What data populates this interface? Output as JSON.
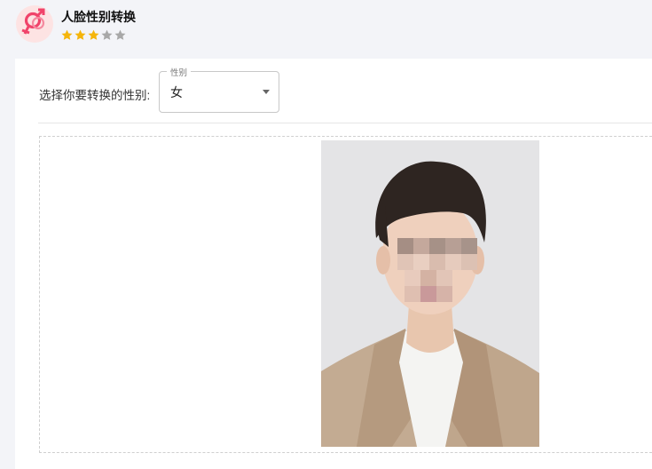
{
  "app": {
    "title": "人脸性别转换",
    "icon": "gender-swap-icon",
    "rating": 3,
    "rating_max": 5,
    "star_color_on": "#f5b50a",
    "star_color_off": "#a8a8a8"
  },
  "form": {
    "gender_label": "选择你要转换的性别:",
    "gender_select": {
      "legend": "性别",
      "value": "女"
    }
  },
  "upload": {
    "image": "uploaded-portrait-photo"
  }
}
